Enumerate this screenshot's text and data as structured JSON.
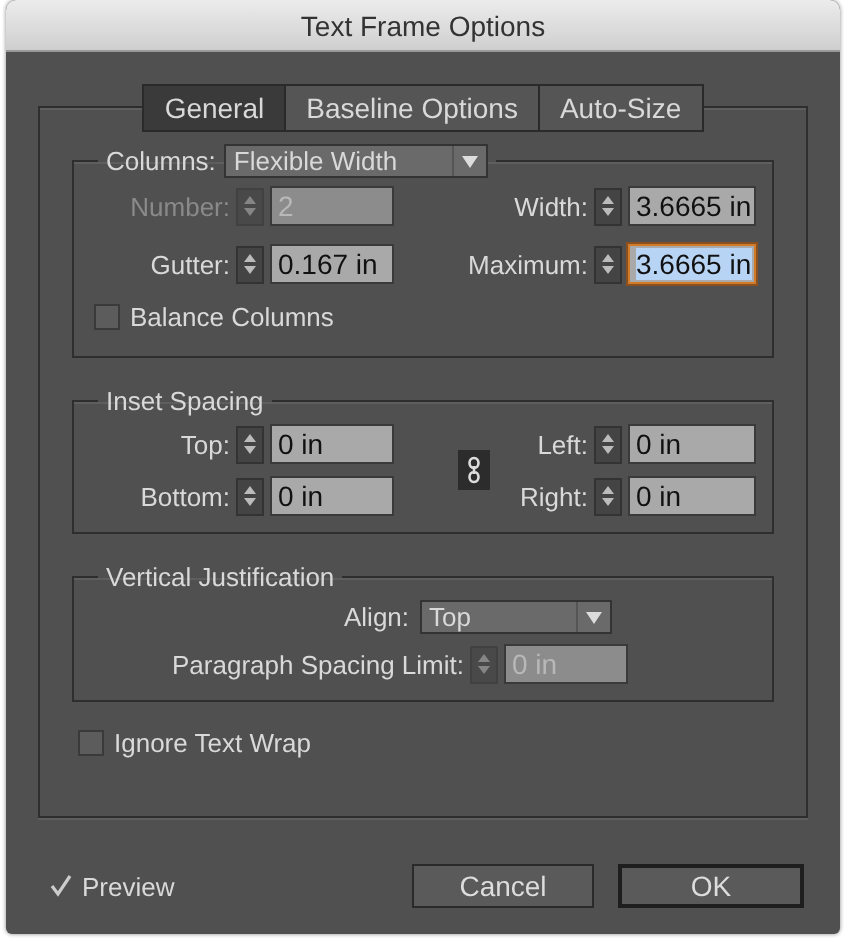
{
  "window": {
    "title": "Text Frame Options"
  },
  "tabs": [
    {
      "label": "General",
      "selected": true
    },
    {
      "label": "Baseline Options",
      "selected": false
    },
    {
      "label": "Auto-Size",
      "selected": false
    }
  ],
  "columns": {
    "label": "Columns:",
    "dropdown": "Flexible Width",
    "fields": [
      {
        "label": "Number:",
        "value": "2",
        "disabled": true,
        "focused": false
      },
      {
        "label": "Width:",
        "value": "3.6665 in",
        "disabled": false,
        "focused": false
      },
      {
        "label": "Gutter:",
        "value": "0.167 in",
        "disabled": false,
        "focused": false
      },
      {
        "label": "Maximum:",
        "value": "3.6665 in",
        "disabled": false,
        "focused": true
      }
    ],
    "balance_columns": {
      "label": "Balance Columns",
      "checked": false
    }
  },
  "inset_spacing": {
    "title": "Inset Spacing",
    "fields": [
      {
        "label": "Top:",
        "value": "0 in"
      },
      {
        "label": "Left:",
        "value": "0 in"
      },
      {
        "label": "Bottom:",
        "value": "0 in"
      },
      {
        "label": "Right:",
        "value": "0 in"
      }
    ]
  },
  "vertical_justification": {
    "title": "Vertical Justification",
    "align": {
      "label": "Align:",
      "value": "Top"
    },
    "paragraph_spacing_limit": {
      "label": "Paragraph Spacing Limit:",
      "value": "0 in",
      "disabled": true
    }
  },
  "ignore_text_wrap": {
    "label": "Ignore Text Wrap",
    "checked": false
  },
  "preview": {
    "label": "Preview",
    "checked": true
  },
  "buttons": [
    {
      "label": "Cancel",
      "kind": "secondary"
    },
    {
      "label": "OK",
      "kind": "default"
    }
  ]
}
